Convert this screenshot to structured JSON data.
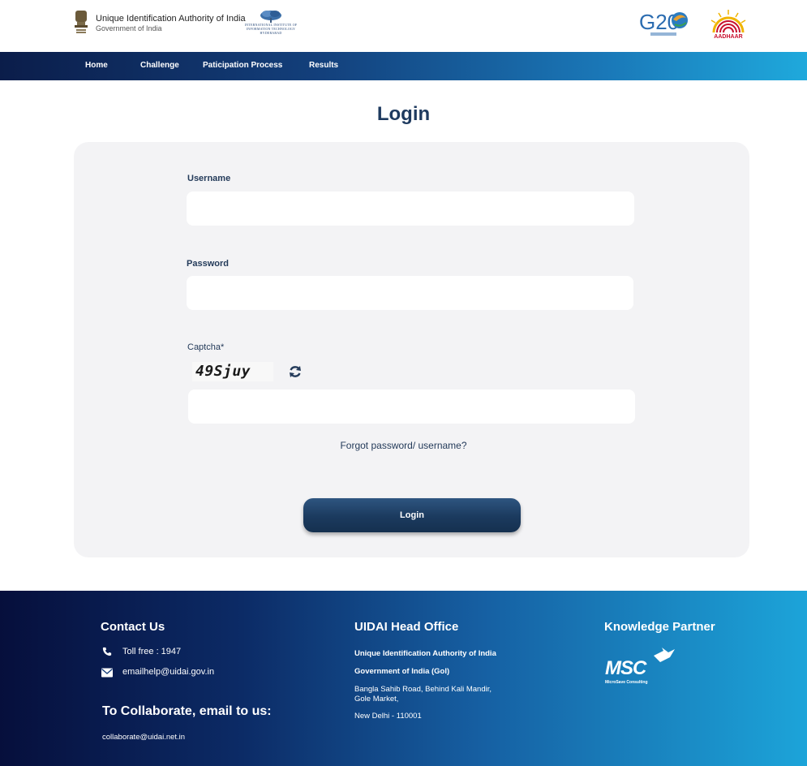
{
  "header": {
    "org_name": "Unique Identification Authority of India",
    "org_gov": "Government of India",
    "iiit_text": "INTERNATIONAL INSTITUTE OF INFORMATION TECHNOLOGY",
    "iiit_city": "HYDERABAD",
    "g20_label": "G20",
    "aadhaar_label": "AADHAAR"
  },
  "nav": {
    "items": [
      {
        "label": "Home"
      },
      {
        "label": "Challenge"
      },
      {
        "label": "Paticipation Process"
      },
      {
        "label": "Results"
      }
    ]
  },
  "page": {
    "title": "Login"
  },
  "form": {
    "username_label": "Username",
    "username_value": "",
    "password_label": "Password",
    "password_value": "",
    "captcha_label": "Captcha*",
    "captcha_text": "49Sjuy",
    "captcha_value": "",
    "forgot_link": "Forgot password/ username?",
    "login_button": "Login"
  },
  "footer": {
    "contact": {
      "heading": "Contact Us",
      "toll_free": "Toll free : 1947",
      "email": "emailhelp@uidai.gov.in"
    },
    "collaborate": {
      "heading": "To Collaborate, email to us:",
      "email": "collaborate@uidai.net.in"
    },
    "head_office": {
      "heading": "UIDAI Head Office",
      "line1": "Unique Identification Authority of India",
      "line2": "Government of India (GoI)",
      "line3": "Bangla Sahib Road, Behind Kali Mandir,",
      "line4": "Gole Market,",
      "line5": "New Delhi - 110001"
    },
    "partner": {
      "heading": "Knowledge Partner",
      "logo_text": "MSC",
      "logo_sub": "MicroSave Consulting"
    }
  },
  "colors": {
    "nav_start": "#0b1d4a",
    "nav_end": "#1fa9dc",
    "title": "#1e3a5f",
    "button": "#1b3a5e",
    "card_bg": "#f3f3f5"
  }
}
